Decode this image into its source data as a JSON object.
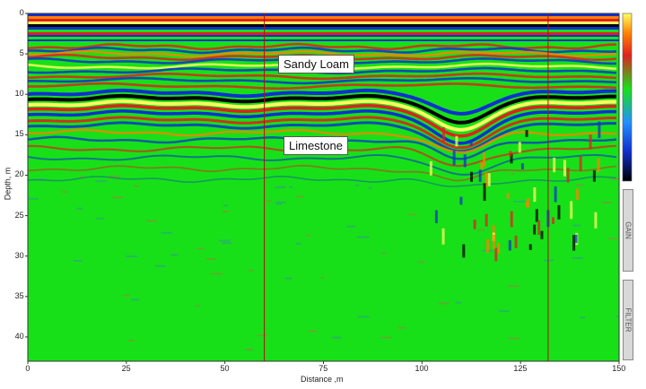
{
  "chart_data": {
    "type": "heatmap",
    "title": "",
    "xlabel": "Distance ,m",
    "ylabel": "Depth, m",
    "xlim": [
      0,
      150
    ],
    "ylim": [
      0,
      43
    ],
    "x_ticks": [
      "0",
      "25",
      "50",
      "75",
      "100",
      "125",
      "150"
    ],
    "y_ticks": [
      "0",
      "5",
      "10",
      "15",
      "20",
      "25",
      "30",
      "35",
      "40"
    ],
    "grid": false,
    "marker_lines_x": [
      60,
      132
    ],
    "annotations": [
      {
        "text": "Sandy Loam",
        "x": 75,
        "y": 5
      },
      {
        "text": "Limestone",
        "x": 74,
        "y": 15.5
      }
    ],
    "colorscale": [
      "#000000",
      "#1030d0",
      "#2090ff",
      "#18e018",
      "#ff8000",
      "#e02020",
      "#ffff60"
    ]
  },
  "side_controls": {
    "gain_label": "GAIN",
    "filter_label": "FILTER"
  }
}
